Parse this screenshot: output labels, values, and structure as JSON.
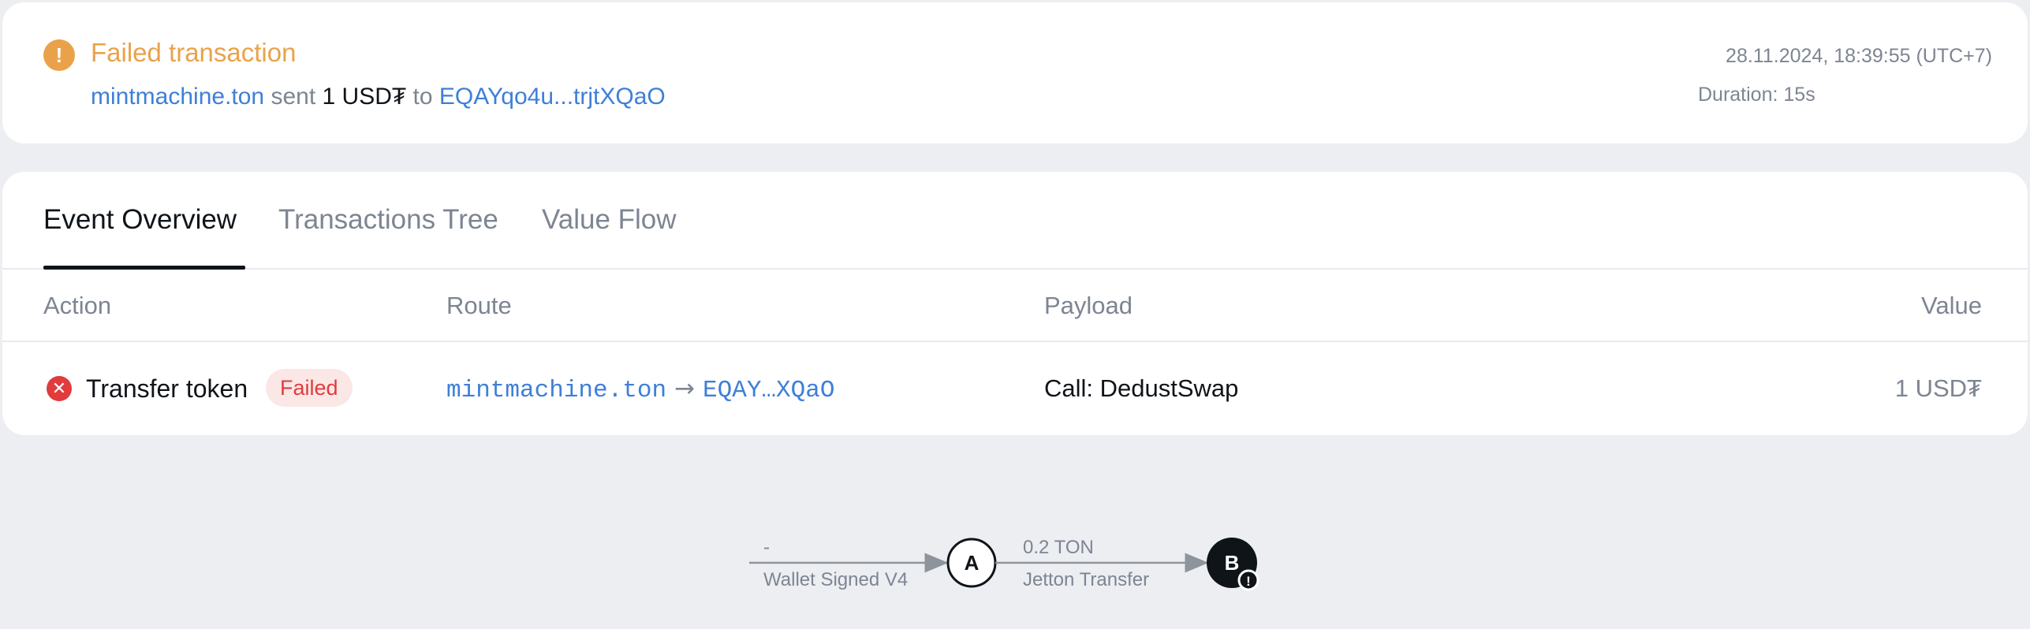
{
  "header": {
    "status_icon": "exclamation-icon",
    "status_title": "Failed transaction",
    "summary": {
      "from": "mintmachine.ton",
      "verb": "sent",
      "amount": "1 USD₮",
      "prep": "to",
      "to": "EQAYqo4u...trjtXQaO"
    },
    "timestamp": "28.11.2024, 18:39:55 (UTC+7)",
    "duration": "Duration: 15s"
  },
  "tabs": [
    {
      "label": "Event Overview",
      "active": true
    },
    {
      "label": "Transactions Tree",
      "active": false
    },
    {
      "label": "Value Flow",
      "active": false
    }
  ],
  "table": {
    "headers": {
      "action": "Action",
      "route": "Route",
      "payload": "Payload",
      "value": "Value"
    },
    "rows": [
      {
        "icon": "close-circle-icon",
        "action": "Transfer token",
        "status": "Failed",
        "route_from": "mintmachine.ton",
        "route_arrow": "→",
        "route_to": "EQAY…XQaO",
        "payload": "Call: DedustSwap",
        "value": "1 USD₮"
      }
    ]
  },
  "flow": {
    "edge1": {
      "top": "-",
      "bottom": "Wallet Signed V4"
    },
    "node_a": "A",
    "edge2": {
      "top": "0.2 TON",
      "bottom": "Jetton Transfer"
    },
    "node_b": "B",
    "node_b_badge": "!"
  },
  "colors": {
    "warning": "#eaa24a",
    "link": "#3e7fd8",
    "error": "#e03c3c",
    "muted": "#7d8592",
    "background": "#eceef2"
  }
}
